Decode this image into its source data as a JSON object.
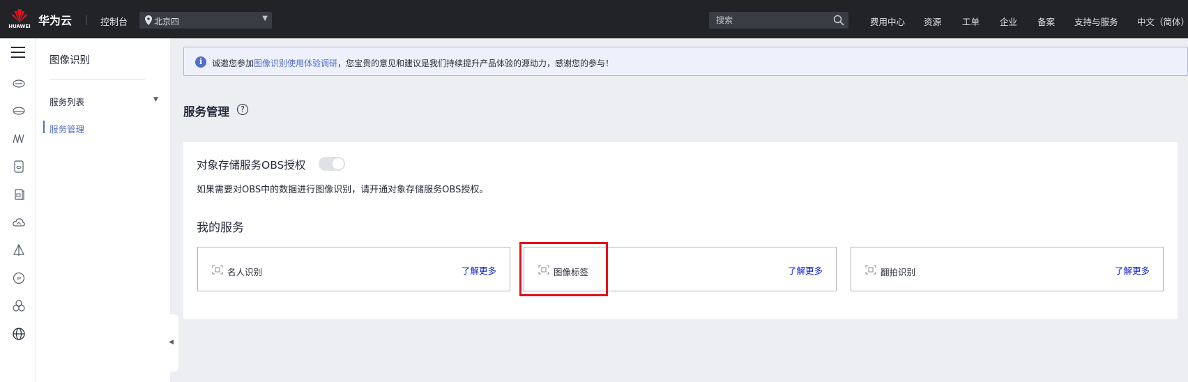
{
  "topbar": {
    "logo_text": "HUAWEI",
    "brand": "华为云",
    "console": "控制台",
    "region": "北京四",
    "search_placeholder": "搜索",
    "nav": [
      "费用中心",
      "资源",
      "工单",
      "企业",
      "备案",
      "支持与服务",
      "中文（简体）"
    ]
  },
  "rail": {
    "icons": [
      "menu-icon",
      "cloud-server-icon",
      "database-icon",
      "ai-icon",
      "storage-icon",
      "bookmark-icon",
      "cloud-icon",
      "network-icon",
      "ip-icon",
      "cluster-icon",
      "globe-icon"
    ]
  },
  "sidenav": {
    "title": "图像识别",
    "group": "服务列表",
    "active_item": "服务管理"
  },
  "notice": {
    "prefix": "诚邀您参加",
    "link": "图像识别使用体验调研",
    "suffix": "，您宝贵的意见和建议是我们持续提升产品体验的源动力，感谢您的参与！"
  },
  "page": {
    "title": "服务管理",
    "help": "?",
    "obs_label": "对象存储服务OBS授权",
    "obs_toggle_on": false,
    "obs_desc": "如果需要对OBS中的数据进行图像识别，请开通对象存储服务OBS授权。",
    "my_services": "我的服务"
  },
  "services": [
    {
      "name": "名人识别",
      "more": "了解更多"
    },
    {
      "name": "图像标签",
      "more": "了解更多"
    },
    {
      "name": "翻拍识别",
      "more": "了解更多"
    }
  ],
  "colors": {
    "topbar": "#222327",
    "accent": "#526ecc",
    "link": "#0a1fd0",
    "highlight": "#e3101a"
  }
}
